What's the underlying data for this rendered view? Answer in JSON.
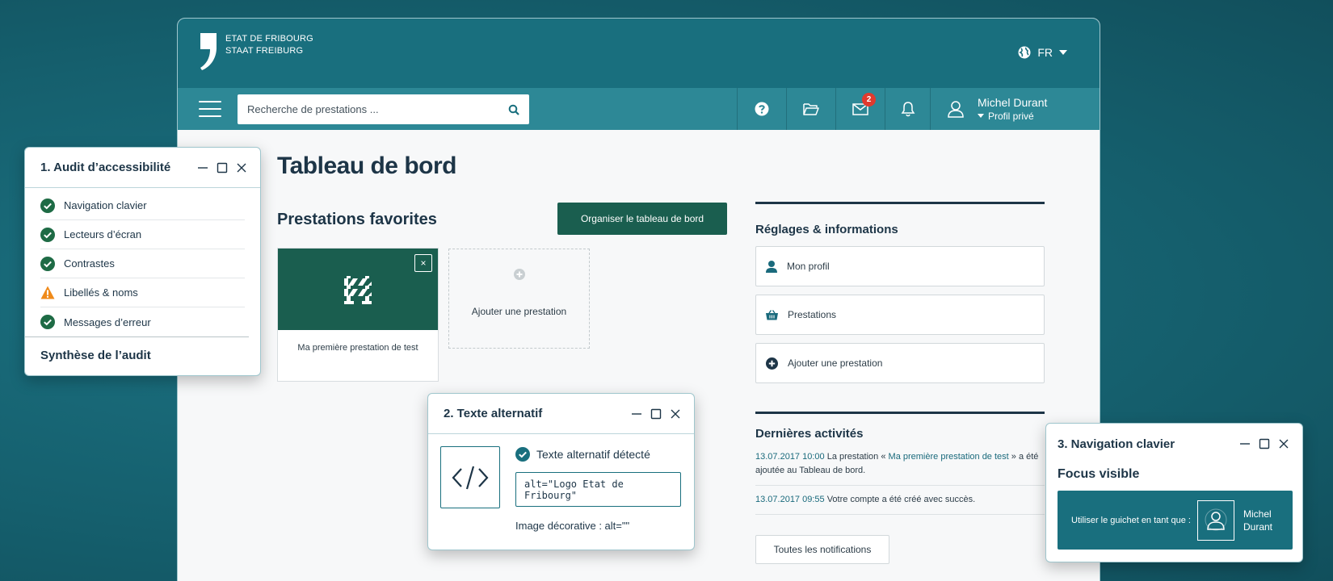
{
  "header": {
    "logo_line1": "ETAT DE FRIBOURG",
    "logo_line2": "STAAT FREIBURG",
    "language": "FR"
  },
  "toolbar": {
    "search_placeholder": "Recherche de prestations ...",
    "mail_badge": "2",
    "user_name": "Michel Durant",
    "user_profile": "Profil privé"
  },
  "main": {
    "title": "Tableau de bord",
    "favorites_title": "Prestations favorites",
    "organise_button": "Organiser le tableau de bord",
    "fav_card_label": "Ma première prestation de test",
    "fav_card_close": "×",
    "add_card_label": "Ajouter une prestation"
  },
  "settings": {
    "title": "Réglages & informations",
    "items": [
      {
        "label": "Mon profil",
        "icon": "user-icon"
      },
      {
        "label": "Prestations",
        "icon": "basket-icon"
      },
      {
        "label": "Ajouter une prestation",
        "icon": "plus-circle-icon"
      }
    ]
  },
  "activities": {
    "title": "Dernières activités",
    "items": [
      {
        "date": "13.07.2017 10:00",
        "pre": " La prestation  « ",
        "link": "Ma première prestation de test",
        "post": " »  a été ajoutée au Tableau de bord."
      },
      {
        "date": "13.07.2017 09:55",
        "text": " Votre compte a été créé avec succès."
      }
    ],
    "all_button": "Toutes les notifications"
  },
  "audit_panel": {
    "title": "1. Audit d’accessibilité",
    "items": [
      {
        "label": "Navigation clavier",
        "status": "ok"
      },
      {
        "label": "Lecteurs d’écran",
        "status": "ok"
      },
      {
        "label": "Contrastes",
        "status": "ok"
      },
      {
        "label": "Libellés & noms",
        "status": "warning"
      },
      {
        "label": "Messages d’erreur",
        "status": "ok"
      }
    ],
    "summary": "Synthèse de l’audit"
  },
  "alt_panel": {
    "title": "2. Texte alternatif",
    "detected": "Texte alternatif détecté",
    "code": "alt=\"Logo Etat de Fribourg\"",
    "decorative": "Image décorative : alt=\"\""
  },
  "nav_panel": {
    "title": "3. Navigation clavier",
    "focus_title": "Focus visible",
    "focus_text": "Utiliser le guichet en tant que :",
    "focus_name_1": "Michel",
    "focus_name_2": "Durant"
  },
  "colors": {
    "background": "#155f6d",
    "header": "#196f7e",
    "toolbar": "#2d8896",
    "accent_dark_green": "#1a5e4f",
    "ok_green": "#1e6b45",
    "warning_orange": "#ef8a1a",
    "badge_red": "#e03a2e"
  }
}
